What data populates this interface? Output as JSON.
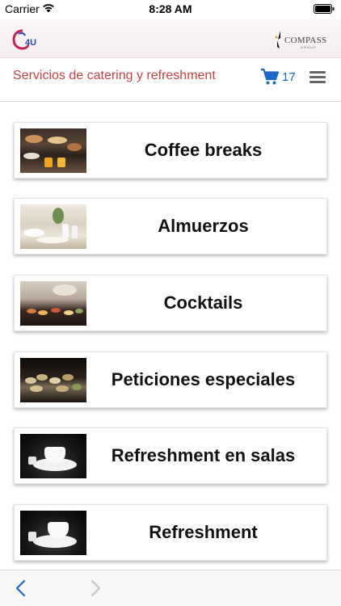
{
  "status_bar": {
    "carrier": "Carrier",
    "time": "8:28 AM",
    "wifi_icon": "wifi-icon",
    "battery_icon": "battery-icon"
  },
  "brand_bar": {
    "app_logo": "c4u-logo",
    "company_logo_text": "COMPASS",
    "company_logo_sub": "GROUP"
  },
  "header": {
    "title": "Servicios de catering y refreshment",
    "cart_count": "17",
    "cart_icon": "shopping-cart-icon",
    "menu_icon": "hamburger-menu-icon",
    "accent_color": "#c94343",
    "cart_color": "#1d69c8"
  },
  "categories": [
    {
      "label": "Coffee breaks",
      "thumbnail": "coffee-break-photo"
    },
    {
      "label": "Almuerzos",
      "thumbnail": "lunch-table-photo"
    },
    {
      "label": "Cocktails",
      "thumbnail": "cocktail-buffet-photo"
    },
    {
      "label": "Peticiones especiales",
      "thumbnail": "special-platter-photo"
    },
    {
      "label": "Refreshment en salas",
      "thumbnail": "coffee-cup-photo"
    },
    {
      "label": "Refreshment",
      "thumbnail": "coffee-cup-photo"
    }
  ],
  "bottom_bar": {
    "back_icon": "chevron-left-icon",
    "forward_icon": "chevron-right-icon",
    "active_color": "#1d69c8"
  }
}
